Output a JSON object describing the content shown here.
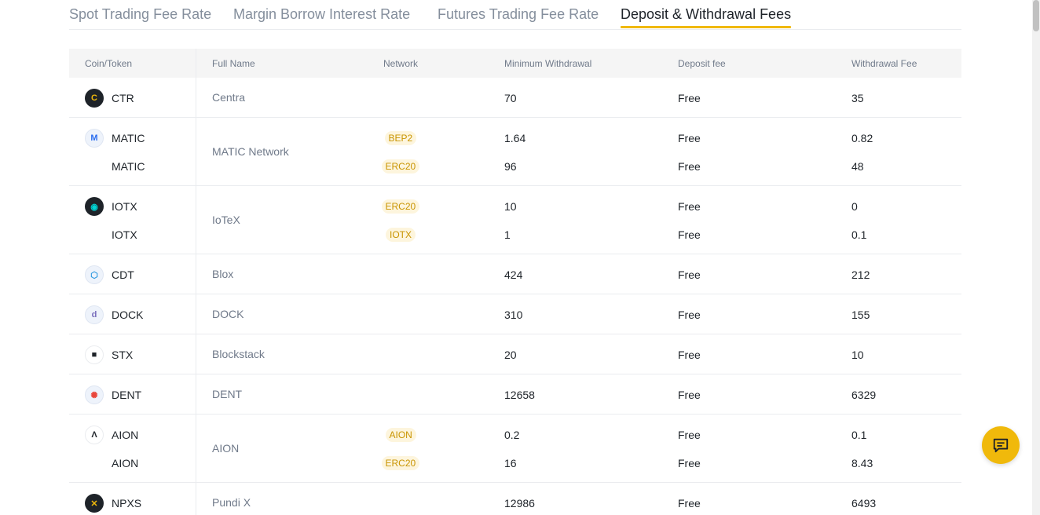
{
  "tabs": [
    {
      "label": "Spot Trading Fee Rate",
      "active": false
    },
    {
      "label": "Margin Borrow Interest Rate",
      "active": false
    },
    {
      "label": "Futures Trading Fee Rate",
      "active": false
    },
    {
      "label": "Deposit & Withdrawal Fees",
      "active": true
    }
  ],
  "table": {
    "headers": {
      "coin": "Coin/Token",
      "full_name": "Full Name",
      "network": "Network",
      "min_withdrawal": "Minimum Withdrawal",
      "deposit_fee": "Deposit fee",
      "withdrawal_fee": "Withdrawal Fee"
    },
    "groups": [
      {
        "full_name": "Centra",
        "icon": "ctr-coin-icon",
        "icon_color": "#f0b90b",
        "rows": [
          {
            "coin": "CTR",
            "network": "",
            "min": "70",
            "deposit": "Free",
            "fee": "35"
          }
        ]
      },
      {
        "full_name": "MATIC Network",
        "icon": "matic-coin-icon",
        "icon_color": "#2b6def",
        "rows": [
          {
            "coin": "MATIC",
            "network": "BEP2",
            "min": "1.64",
            "deposit": "Free",
            "fee": "0.82"
          },
          {
            "coin": "MATIC",
            "network": "ERC20",
            "min": "96",
            "deposit": "Free",
            "fee": "48"
          }
        ]
      },
      {
        "full_name": "IoTeX",
        "icon": "iotx-coin-icon",
        "icon_color": "#00d4d5",
        "rows": [
          {
            "coin": "IOTX",
            "network": "ERC20",
            "min": "10",
            "deposit": "Free",
            "fee": "0"
          },
          {
            "coin": "IOTX",
            "network": "IOTX",
            "min": "1",
            "deposit": "Free",
            "fee": "0.1"
          }
        ]
      },
      {
        "full_name": "Blox",
        "icon": "cdt-coin-icon",
        "icon_color": "#2f9ae0",
        "rows": [
          {
            "coin": "CDT",
            "network": "",
            "min": "424",
            "deposit": "Free",
            "fee": "212"
          }
        ]
      },
      {
        "full_name": "DOCK",
        "icon": "dock-coin-icon",
        "icon_color": "#786dbc",
        "rows": [
          {
            "coin": "DOCK",
            "network": "",
            "min": "310",
            "deposit": "Free",
            "fee": "155"
          }
        ]
      },
      {
        "full_name": "Blockstack",
        "icon": "stx-coin-icon",
        "icon_color": "#1e2329",
        "rows": [
          {
            "coin": "STX",
            "network": "",
            "min": "20",
            "deposit": "Free",
            "fee": "10"
          }
        ]
      },
      {
        "full_name": "DENT",
        "icon": "dent-coin-icon",
        "icon_color": "#e9463b",
        "rows": [
          {
            "coin": "DENT",
            "network": "",
            "min": "12658",
            "deposit": "Free",
            "fee": "6329"
          }
        ]
      },
      {
        "full_name": "AION",
        "icon": "aion-coin-icon",
        "icon_color": "#1e2329",
        "rows": [
          {
            "coin": "AION",
            "network": "AION",
            "min": "0.2",
            "deposit": "Free",
            "fee": "0.1"
          },
          {
            "coin": "AION",
            "network": "ERC20",
            "min": "16",
            "deposit": "Free",
            "fee": "8.43"
          }
        ]
      },
      {
        "full_name": "Pundi X",
        "icon": "npxs-coin-icon",
        "icon_color": "#f0b90b",
        "rows": [
          {
            "coin": "NPXS",
            "network": "",
            "min": "12986",
            "deposit": "Free",
            "fee": "6493"
          }
        ]
      }
    ]
  },
  "chat_button": {
    "icon": "chat-icon"
  },
  "colors": {
    "accent": "#f0b90b",
    "text": "#1e2329",
    "muted": "#707a8a",
    "badge_bg": "#fdf5dd",
    "badge_text": "#c99400"
  }
}
